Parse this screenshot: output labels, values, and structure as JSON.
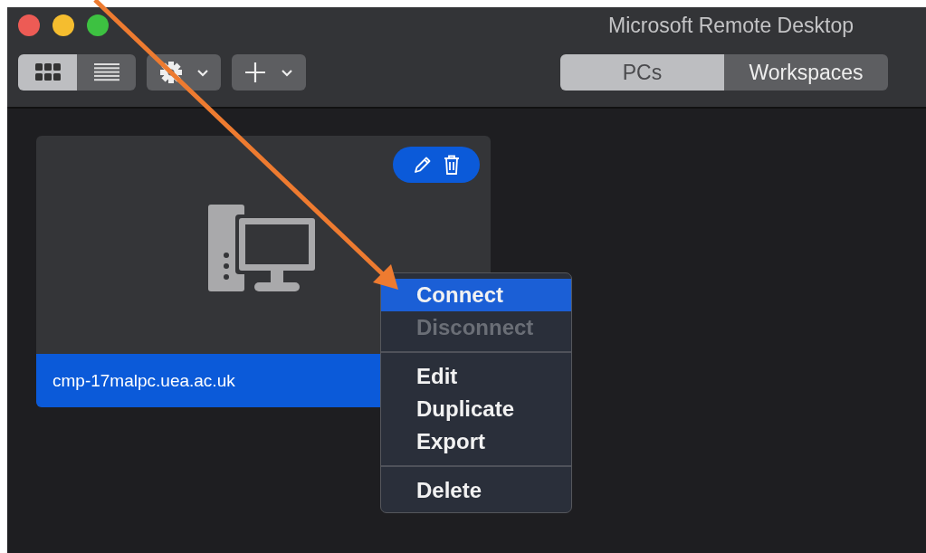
{
  "window": {
    "title": "Microsoft Remote Desktop"
  },
  "view_toggle": [
    {
      "kind": "grid",
      "selected": true
    },
    {
      "kind": "list",
      "selected": false
    }
  ],
  "toolbar_menus": [
    {
      "kind": "gear"
    },
    {
      "kind": "plus"
    }
  ],
  "segments": [
    {
      "label": "PCs",
      "selected": true
    },
    {
      "label": "Workspaces",
      "selected": false
    }
  ],
  "pcs": [
    {
      "name": "cmp-17malpc.uea.ac.uk",
      "selected": true
    }
  ],
  "context_menu": [
    {
      "kind": "item",
      "label": "Connect",
      "highlighted": true,
      "disabled": false
    },
    {
      "kind": "item",
      "label": "Disconnect",
      "highlighted": false,
      "disabled": true
    },
    {
      "kind": "separator"
    },
    {
      "kind": "item",
      "label": "Edit",
      "highlighted": false,
      "disabled": false
    },
    {
      "kind": "item",
      "label": "Duplicate",
      "highlighted": false,
      "disabled": false
    },
    {
      "kind": "item",
      "label": "Export",
      "highlighted": false,
      "disabled": false
    },
    {
      "kind": "separator"
    },
    {
      "kind": "item",
      "label": "Delete",
      "highlighted": false,
      "disabled": false
    }
  ]
}
